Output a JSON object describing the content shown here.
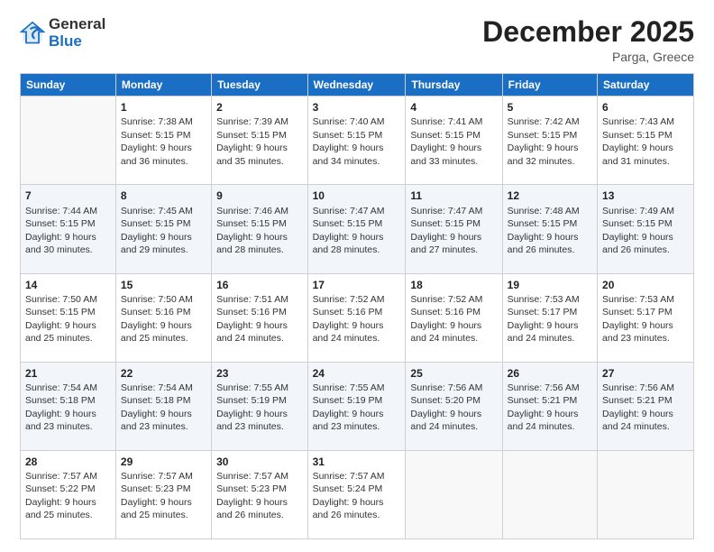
{
  "logo": {
    "general": "General",
    "blue": "Blue"
  },
  "title": "December 2025",
  "subtitle": "Parga, Greece",
  "days_of_week": [
    "Sunday",
    "Monday",
    "Tuesday",
    "Wednesday",
    "Thursday",
    "Friday",
    "Saturday"
  ],
  "weeks": [
    [
      {
        "day": "",
        "info": ""
      },
      {
        "day": "1",
        "info": "Sunrise: 7:38 AM\nSunset: 5:15 PM\nDaylight: 9 hours\nand 36 minutes."
      },
      {
        "day": "2",
        "info": "Sunrise: 7:39 AM\nSunset: 5:15 PM\nDaylight: 9 hours\nand 35 minutes."
      },
      {
        "day": "3",
        "info": "Sunrise: 7:40 AM\nSunset: 5:15 PM\nDaylight: 9 hours\nand 34 minutes."
      },
      {
        "day": "4",
        "info": "Sunrise: 7:41 AM\nSunset: 5:15 PM\nDaylight: 9 hours\nand 33 minutes."
      },
      {
        "day": "5",
        "info": "Sunrise: 7:42 AM\nSunset: 5:15 PM\nDaylight: 9 hours\nand 32 minutes."
      },
      {
        "day": "6",
        "info": "Sunrise: 7:43 AM\nSunset: 5:15 PM\nDaylight: 9 hours\nand 31 minutes."
      }
    ],
    [
      {
        "day": "7",
        "info": "Sunrise: 7:44 AM\nSunset: 5:15 PM\nDaylight: 9 hours\nand 30 minutes."
      },
      {
        "day": "8",
        "info": "Sunrise: 7:45 AM\nSunset: 5:15 PM\nDaylight: 9 hours\nand 29 minutes."
      },
      {
        "day": "9",
        "info": "Sunrise: 7:46 AM\nSunset: 5:15 PM\nDaylight: 9 hours\nand 28 minutes."
      },
      {
        "day": "10",
        "info": "Sunrise: 7:47 AM\nSunset: 5:15 PM\nDaylight: 9 hours\nand 28 minutes."
      },
      {
        "day": "11",
        "info": "Sunrise: 7:47 AM\nSunset: 5:15 PM\nDaylight: 9 hours\nand 27 minutes."
      },
      {
        "day": "12",
        "info": "Sunrise: 7:48 AM\nSunset: 5:15 PM\nDaylight: 9 hours\nand 26 minutes."
      },
      {
        "day": "13",
        "info": "Sunrise: 7:49 AM\nSunset: 5:15 PM\nDaylight: 9 hours\nand 26 minutes."
      }
    ],
    [
      {
        "day": "14",
        "info": "Sunrise: 7:50 AM\nSunset: 5:15 PM\nDaylight: 9 hours\nand 25 minutes."
      },
      {
        "day": "15",
        "info": "Sunrise: 7:50 AM\nSunset: 5:16 PM\nDaylight: 9 hours\nand 25 minutes."
      },
      {
        "day": "16",
        "info": "Sunrise: 7:51 AM\nSunset: 5:16 PM\nDaylight: 9 hours\nand 24 minutes."
      },
      {
        "day": "17",
        "info": "Sunrise: 7:52 AM\nSunset: 5:16 PM\nDaylight: 9 hours\nand 24 minutes."
      },
      {
        "day": "18",
        "info": "Sunrise: 7:52 AM\nSunset: 5:16 PM\nDaylight: 9 hours\nand 24 minutes."
      },
      {
        "day": "19",
        "info": "Sunrise: 7:53 AM\nSunset: 5:17 PM\nDaylight: 9 hours\nand 24 minutes."
      },
      {
        "day": "20",
        "info": "Sunrise: 7:53 AM\nSunset: 5:17 PM\nDaylight: 9 hours\nand 23 minutes."
      }
    ],
    [
      {
        "day": "21",
        "info": "Sunrise: 7:54 AM\nSunset: 5:18 PM\nDaylight: 9 hours\nand 23 minutes."
      },
      {
        "day": "22",
        "info": "Sunrise: 7:54 AM\nSunset: 5:18 PM\nDaylight: 9 hours\nand 23 minutes."
      },
      {
        "day": "23",
        "info": "Sunrise: 7:55 AM\nSunset: 5:19 PM\nDaylight: 9 hours\nand 23 minutes."
      },
      {
        "day": "24",
        "info": "Sunrise: 7:55 AM\nSunset: 5:19 PM\nDaylight: 9 hours\nand 23 minutes."
      },
      {
        "day": "25",
        "info": "Sunrise: 7:56 AM\nSunset: 5:20 PM\nDaylight: 9 hours\nand 24 minutes."
      },
      {
        "day": "26",
        "info": "Sunrise: 7:56 AM\nSunset: 5:21 PM\nDaylight: 9 hours\nand 24 minutes."
      },
      {
        "day": "27",
        "info": "Sunrise: 7:56 AM\nSunset: 5:21 PM\nDaylight: 9 hours\nand 24 minutes."
      }
    ],
    [
      {
        "day": "28",
        "info": "Sunrise: 7:57 AM\nSunset: 5:22 PM\nDaylight: 9 hours\nand 25 minutes."
      },
      {
        "day": "29",
        "info": "Sunrise: 7:57 AM\nSunset: 5:23 PM\nDaylight: 9 hours\nand 25 minutes."
      },
      {
        "day": "30",
        "info": "Sunrise: 7:57 AM\nSunset: 5:23 PM\nDaylight: 9 hours\nand 26 minutes."
      },
      {
        "day": "31",
        "info": "Sunrise: 7:57 AM\nSunset: 5:24 PM\nDaylight: 9 hours\nand 26 minutes."
      },
      {
        "day": "",
        "info": ""
      },
      {
        "day": "",
        "info": ""
      },
      {
        "day": "",
        "info": ""
      }
    ]
  ]
}
